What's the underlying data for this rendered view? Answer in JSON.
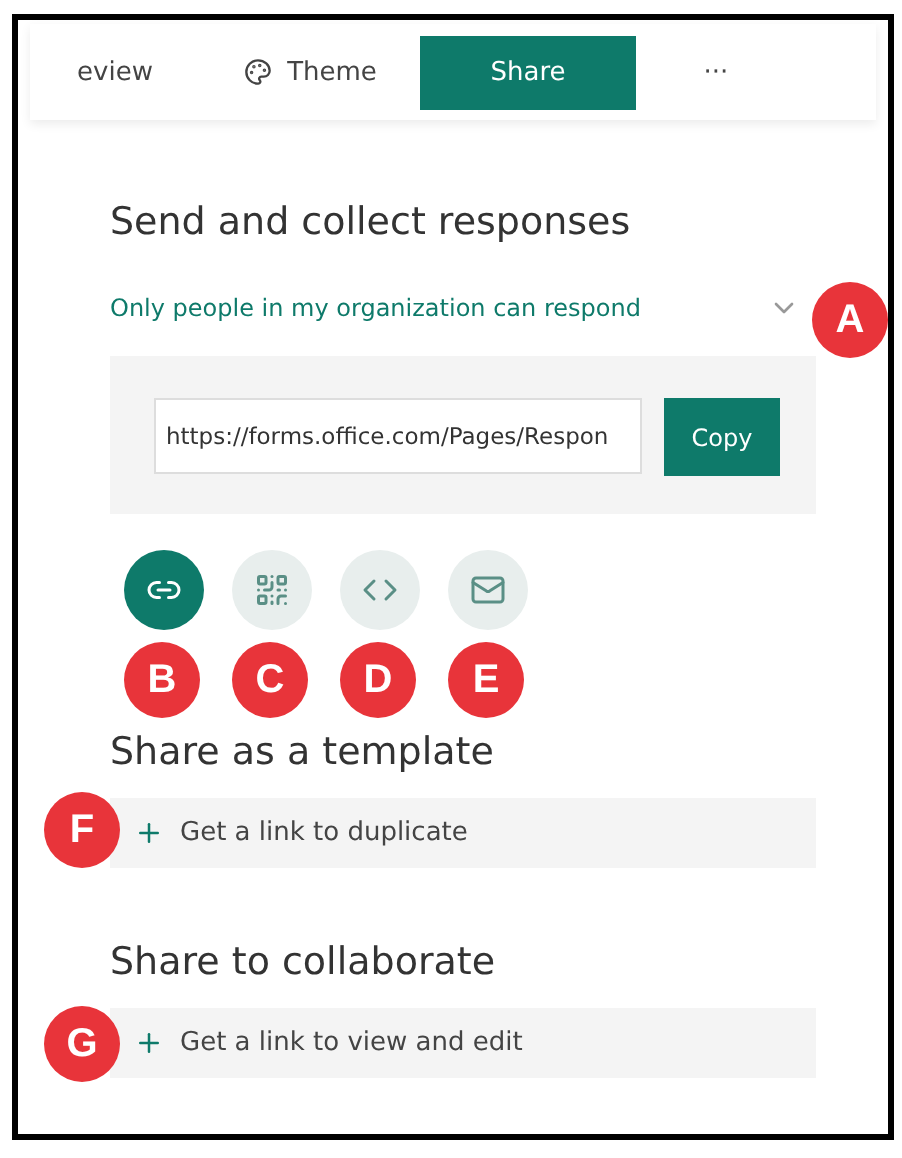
{
  "tabs": [
    {
      "label": "eview",
      "kind": "text",
      "selected": false
    },
    {
      "label": "Theme",
      "kind": "icon-text",
      "selected": false
    },
    {
      "label": "Share",
      "kind": "text",
      "selected": true
    },
    {
      "label": "···",
      "kind": "text",
      "selected": false
    }
  ],
  "send": {
    "heading": "Send and collect responses",
    "audience": "Only people in my organization can respond",
    "link": "https://forms.office.com/Pages/Respon",
    "copy_button": "Copy",
    "methods": [
      {
        "kind": "link",
        "selected": true
      },
      {
        "kind": "qr",
        "selected": false
      },
      {
        "kind": "embed",
        "selected": false
      },
      {
        "kind": "email",
        "selected": false
      }
    ]
  },
  "sections": [
    {
      "heading": "Share as a template",
      "action": "Get a link to duplicate"
    },
    {
      "heading": "Share to collaborate",
      "action": "Get a link to view and edit"
    }
  ],
  "callouts": {
    "audience": "A",
    "methods": [
      "B",
      "C",
      "D",
      "E"
    ],
    "sections": [
      "F",
      "G"
    ]
  }
}
